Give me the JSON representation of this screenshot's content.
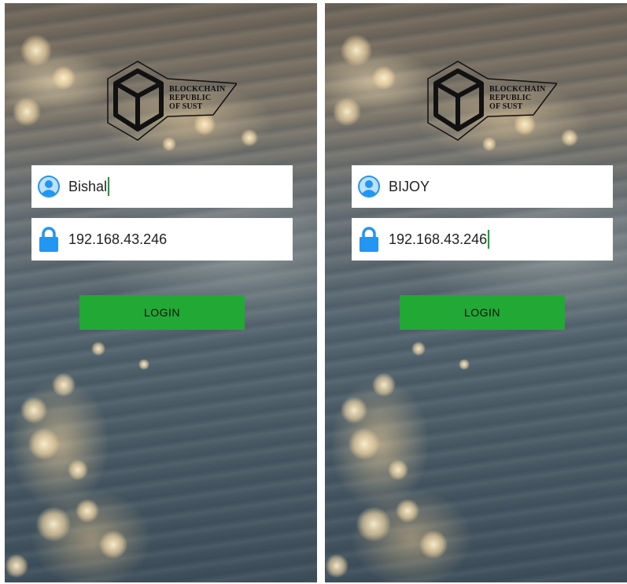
{
  "logo": {
    "line1": "BLOCKCHAIN",
    "line2": "REPUBLIC",
    "line3": "OF SUST",
    "icon": "blockchain-cube-logo-icon"
  },
  "screens": [
    {
      "username": {
        "value": "Bishal",
        "icon": "user-avatar-icon",
        "has_caret": true
      },
      "password": {
        "value": "192.168.43.246",
        "icon": "lock-icon",
        "has_caret": false
      },
      "login_label": "LOGIN"
    },
    {
      "username": {
        "value": "BIJOY",
        "icon": "user-avatar-icon",
        "has_caret": false
      },
      "password": {
        "value": "192.168.43.246",
        "icon": "lock-icon",
        "has_caret": true
      },
      "login_label": "LOGIN"
    }
  ],
  "colors": {
    "accent_button": "#22a835",
    "caret": "#1f9c3a",
    "icon_blue": "#2196f3",
    "field_bg": "#ffffff"
  }
}
